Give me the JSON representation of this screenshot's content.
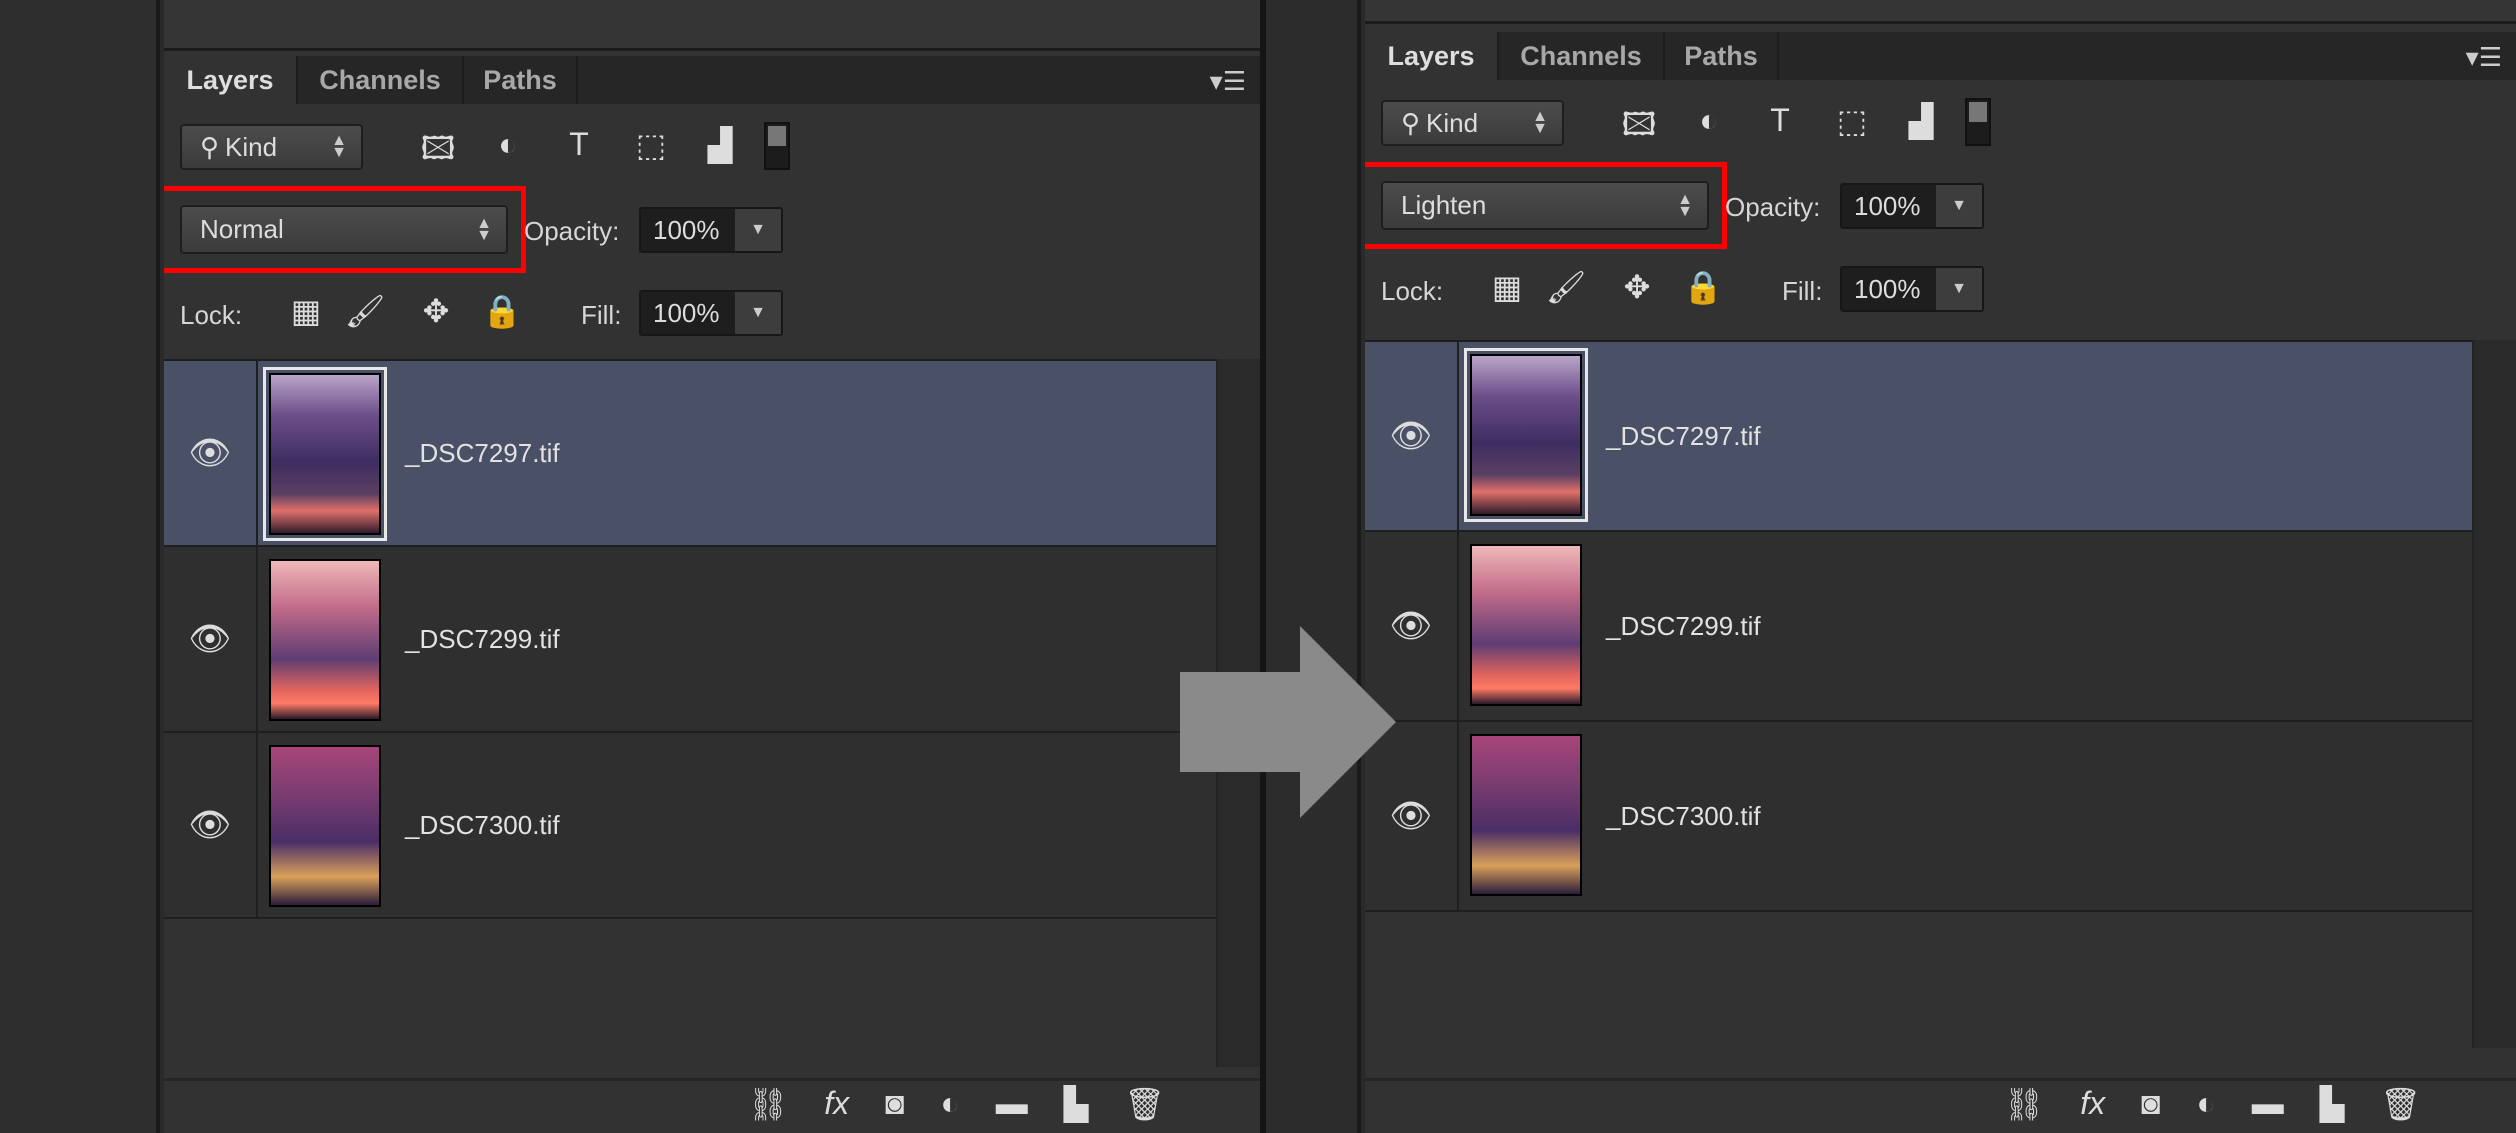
{
  "panels": [
    {
      "id": "before",
      "tabs": [
        "Layers",
        "Channels",
        "Paths"
      ],
      "active_tab": "Layers",
      "filter": "Kind",
      "blend_mode": "Normal",
      "opacity_label": "Opacity:",
      "opacity": "100%",
      "lock_label": "Lock:",
      "fill_label": "Fill:",
      "fill": "100%",
      "layers": [
        {
          "name": "_DSC7297.tif",
          "selected": true,
          "visible": true
        },
        {
          "name": "_DSC7299.tif",
          "selected": false,
          "visible": true
        },
        {
          "name": "_DSC7300.tif",
          "selected": false,
          "visible": true
        }
      ]
    },
    {
      "id": "after",
      "tabs": [
        "Layers",
        "Channels",
        "Paths"
      ],
      "active_tab": "Layers",
      "filter": "Kind",
      "blend_mode": "Lighten",
      "opacity_label": "Opacity:",
      "opacity": "100%",
      "lock_label": "Lock:",
      "fill_label": "Fill:",
      "fill": "100%",
      "layers": [
        {
          "name": "_DSC7297.tif",
          "selected": true,
          "visible": true
        },
        {
          "name": "_DSC7299.tif",
          "selected": false,
          "visible": true
        },
        {
          "name": "_DSC7300.tif",
          "selected": false,
          "visible": true
        }
      ]
    }
  ],
  "highlight_color": "#ff0000",
  "selected_row_color": "#4a5066"
}
